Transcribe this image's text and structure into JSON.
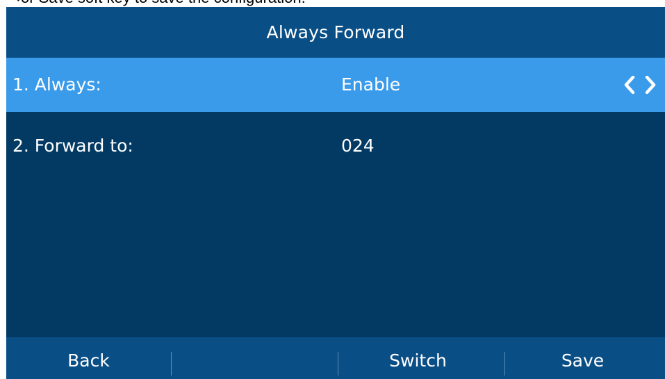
{
  "caption": {
    "text": "or Save soft key to save the configuration.",
    "arrow_icon": "right-arrow-icon"
  },
  "screen": {
    "title": "Always Forward",
    "rows": [
      {
        "label": "1. Always:",
        "value": "Enable",
        "selected": true,
        "arrows": [
          "left-chevron-icon",
          "right-chevron-icon"
        ]
      },
      {
        "label": "2. Forward to:",
        "value": "024",
        "selected": false
      }
    ],
    "softkeys": [
      "Back",
      "",
      "Switch",
      "Save"
    ]
  },
  "colors": {
    "screen_background": "#023a64",
    "bar_background": "#0a4e86",
    "selected_row": "#3a9bea",
    "text": "#ffffff"
  }
}
